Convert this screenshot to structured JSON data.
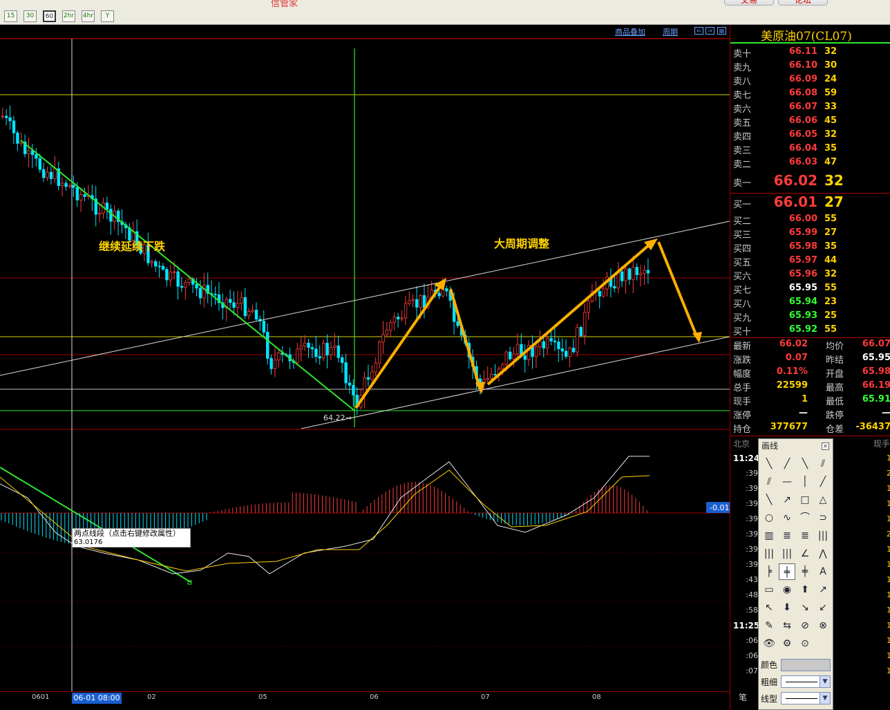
{
  "toolbar": {
    "periods": [
      "15",
      "30",
      "60",
      "2hr",
      "4hr",
      "Y"
    ],
    "selected_period": "60",
    "app_title": "信管家",
    "trade_label": "交易",
    "forum_label": "论坛"
  },
  "chart_header": {
    "overlay_link": "商品叠加",
    "cycle_link": "周期"
  },
  "chart": {
    "annotation_down": "继续延续下跌",
    "annotation_adjust": "大周期调整",
    "low_price_label": "64.22",
    "tooltip_title": "两点线段（点击右键修改属性）",
    "tooltip_value": "63.0176",
    "macd_value": "-0.01",
    "colors": {
      "up": "#ff3b3b",
      "down": "#00e5ff",
      "arrow": "#ffb000",
      "trend": "#2ee82e",
      "h_yellow": "#ffff00",
      "h_red": "#c00000",
      "channel": "#ffffff"
    }
  },
  "time_axis": {
    "labels": [
      "0601",
      "02",
      "05",
      "06",
      "07",
      "08"
    ],
    "cursor": "06-01 08:00"
  },
  "quote": {
    "title": "美原油07(CL07)",
    "asks": [
      {
        "label": "卖十",
        "price": "66.11",
        "vol": "32"
      },
      {
        "label": "卖九",
        "price": "66.10",
        "vol": "30"
      },
      {
        "label": "卖八",
        "price": "66.09",
        "vol": "24"
      },
      {
        "label": "卖七",
        "price": "66.08",
        "vol": "59"
      },
      {
        "label": "卖六",
        "price": "66.07",
        "vol": "33"
      },
      {
        "label": "卖五",
        "price": "66.06",
        "vol": "45"
      },
      {
        "label": "卖四",
        "price": "66.05",
        "vol": "32"
      },
      {
        "label": "卖三",
        "price": "66.04",
        "vol": "35"
      },
      {
        "label": "卖二",
        "price": "66.03",
        "vol": "47"
      }
    ],
    "ask1": {
      "label": "卖一",
      "price": "66.02",
      "vol": "32"
    },
    "bid1": {
      "label": "买一",
      "price": "66.01",
      "vol": "27"
    },
    "bids": [
      {
        "label": "买二",
        "price": "66.00",
        "vol": "55",
        "color": "#ff3b3b"
      },
      {
        "label": "买三",
        "price": "65.99",
        "vol": "27",
        "color": "#ff3b3b"
      },
      {
        "label": "买四",
        "price": "65.98",
        "vol": "35",
        "color": "#ff3b3b"
      },
      {
        "label": "买五",
        "price": "65.97",
        "vol": "44",
        "color": "#ff3b3b"
      },
      {
        "label": "买六",
        "price": "65.96",
        "vol": "32",
        "color": "#ff3b3b"
      },
      {
        "label": "买七",
        "price": "65.95",
        "vol": "55",
        "color": "#ffffff"
      },
      {
        "label": "买八",
        "price": "65.94",
        "vol": "23",
        "color": "#33ff33"
      },
      {
        "label": "买九",
        "price": "65.93",
        "vol": "25",
        "color": "#33ff33"
      },
      {
        "label": "买十",
        "price": "65.92",
        "vol": "55",
        "color": "#33ff33"
      }
    ],
    "stats": [
      {
        "l1": "最新",
        "v1": "66.02",
        "c1": "#ff3b3b",
        "l2": "均价",
        "v2": "66.07",
        "c2": "#ff3b3b"
      },
      {
        "l1": "涨跌",
        "v1": "0.07",
        "c1": "#ff3b3b",
        "l2": "昨结",
        "v2": "65.95",
        "c2": "#ffffff"
      },
      {
        "l1": "幅度",
        "v1": "0.11%",
        "c1": "#ff3b3b",
        "l2": "开盘",
        "v2": "65.98",
        "c2": "#ff3b3b"
      },
      {
        "l1": "总手",
        "v1": "22599",
        "c1": "#ffd400",
        "l2": "最高",
        "v2": "66.19",
        "c2": "#ff3b3b"
      },
      {
        "l1": "现手",
        "v1": "1",
        "c1": "#ffd400",
        "l2": "最低",
        "v2": "65.91",
        "c2": "#33ff33"
      },
      {
        "l1": "涨停",
        "v1": "—",
        "c1": "#ffffff",
        "l2": "跌停",
        "v2": "—",
        "c2": "#ffffff"
      },
      {
        "l1": "持仓",
        "v1": "377677",
        "c1": "#ffd400",
        "l2": "仓差",
        "v2": "-36437",
        "c2": "#ffd400"
      }
    ],
    "ticks_header": {
      "left": "北京",
      "right": "现手"
    },
    "ticks": [
      ":24",
      ":39",
      ":39",
      ":39",
      ":39",
      ":39",
      ":39",
      ":39",
      ":43",
      ":48",
      ":58",
      "11:25",
      ":06",
      ":06",
      ":07"
    ],
    "tick_first_hour": "11:24",
    "tick_right_values": [
      "1",
      "2",
      "1",
      "1",
      "1",
      "2",
      "1",
      "1",
      "1",
      "1",
      "1",
      "1",
      "1",
      "1",
      "1"
    ],
    "bottom_label": "笔"
  },
  "palette": {
    "title": "画线",
    "tools": [
      "╲",
      "╱",
      "╲",
      "⫽",
      "⫽",
      "—",
      "│",
      "╱",
      "╲",
      "↗",
      "□",
      "△",
      "○",
      "∿",
      "⌒",
      "⊃",
      "▥",
      "≣",
      "≣",
      "|||",
      "|||",
      "|||",
      "∠",
      "⋀",
      "╞",
      "╪",
      "╪",
      "A",
      "▭",
      "◉",
      "⬆",
      "↗",
      "↖",
      "⬇",
      "↘",
      "↙",
      "✎",
      "⇆",
      "⊘",
      "⊗",
      "👁",
      "⚙",
      "⊙"
    ],
    "color_label": "颜色",
    "width_label": "粗细",
    "line_label": "线型"
  }
}
